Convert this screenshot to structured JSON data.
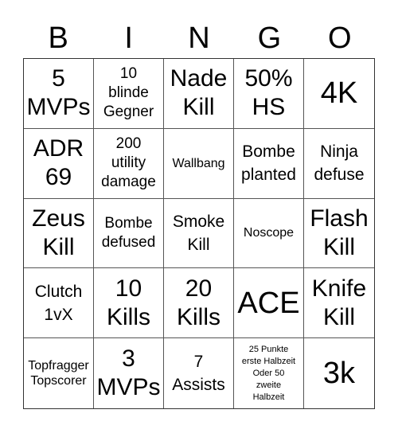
{
  "header": {
    "letters": [
      "B",
      "I",
      "N",
      "G",
      "O"
    ]
  },
  "cells": [
    "5\nMVPs",
    "10\nblinde\nGegner",
    "Nade\nKill",
    "50%\nHS",
    "4K",
    "ADR\n69",
    "200\nutility\ndamage",
    "Wallbang",
    "Bombe\nplanted",
    "Ninja\ndefuse",
    "Zeus\nKill",
    "Bombe\ndefused",
    "Smoke\nKill",
    "Noscope",
    "Flash\nKill",
    "Clutch\n1vX",
    "10\nKills",
    "20\nKills",
    "ACE",
    "Knife\nKill",
    "Topfragger\nTopscorer",
    "3\nMVPs",
    "7\nAssists",
    "25 Punkte\nerste Halbzeit\nOder 50\nzweite\nHalbzeit",
    "3k"
  ]
}
